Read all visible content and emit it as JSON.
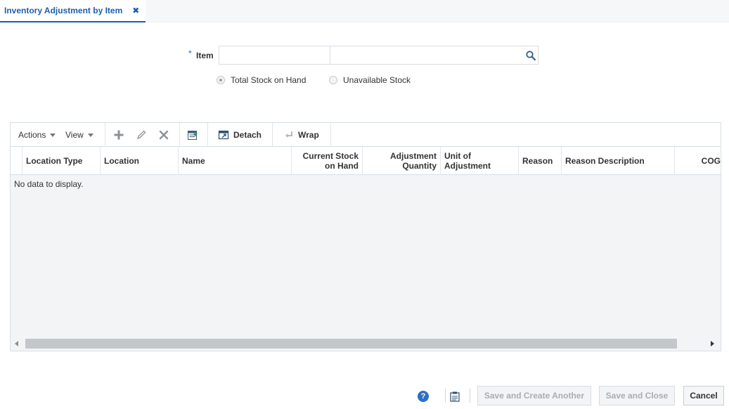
{
  "tab": {
    "title": "Inventory Adjustment by Item",
    "close": "✖"
  },
  "form": {
    "required_marker": "*",
    "item_label": "Item",
    "item_value": "",
    "item_desc": "",
    "radio": {
      "total": {
        "label": "Total Stock on Hand",
        "selected": true
      },
      "unavailable": {
        "label": "Unavailable Stock",
        "selected": false
      }
    }
  },
  "toolbar": {
    "actions": "Actions",
    "view": "View",
    "detach": "Detach",
    "wrap": "Wrap"
  },
  "table": {
    "columns": {
      "location_type": "Location Type",
      "location": "Location",
      "name": "Name",
      "current_stock_1": "Current Stock",
      "current_stock_2": "on Hand",
      "adj_qty_1": "Adjustment",
      "adj_qty_2": "Quantity",
      "unit_adj_1": "Unit of",
      "unit_adj_2": "Adjustment",
      "reason": "Reason",
      "reason_desc": "Reason Description",
      "cogs": "COG"
    },
    "empty_text": "No data to display."
  },
  "footer": {
    "help": "?",
    "save_create": "Save and Create Another",
    "save_close": "Save and Close",
    "cancel": "Cancel"
  },
  "icons": {
    "close": "close-icon",
    "search": "search-icon",
    "add": "add-icon",
    "edit": "edit-icon",
    "delete": "delete-icon",
    "export": "export-icon",
    "detach": "detach-icon",
    "wrap": "wrap-icon",
    "help": "help-icon",
    "clipboard": "clipboard-icon"
  },
  "colors": {
    "accent": "#1f5ea8",
    "help_icon": "#2b70c4",
    "disabled_text": "#a8adb2"
  }
}
